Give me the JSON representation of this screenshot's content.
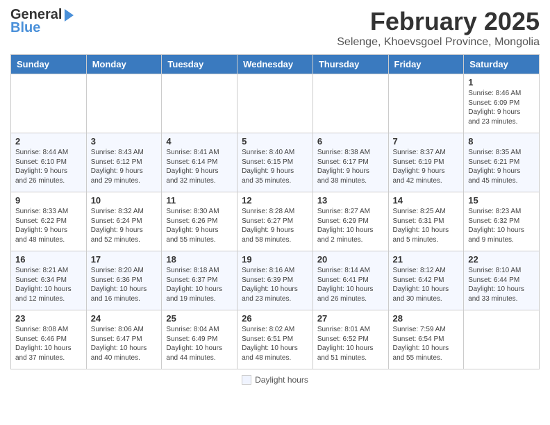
{
  "header": {
    "logo_line1": "General",
    "logo_line2": "Blue",
    "month_title": "February 2025",
    "subtitle": "Selenge, Khoevsgoel Province, Mongolia"
  },
  "weekdays": [
    "Sunday",
    "Monday",
    "Tuesday",
    "Wednesday",
    "Thursday",
    "Friday",
    "Saturday"
  ],
  "weeks": [
    [
      {
        "day": "",
        "info": ""
      },
      {
        "day": "",
        "info": ""
      },
      {
        "day": "",
        "info": ""
      },
      {
        "day": "",
        "info": ""
      },
      {
        "day": "",
        "info": ""
      },
      {
        "day": "",
        "info": ""
      },
      {
        "day": "1",
        "info": "Sunrise: 8:46 AM\nSunset: 6:09 PM\nDaylight: 9 hours\nand 23 minutes."
      }
    ],
    [
      {
        "day": "2",
        "info": "Sunrise: 8:44 AM\nSunset: 6:10 PM\nDaylight: 9 hours\nand 26 minutes."
      },
      {
        "day": "3",
        "info": "Sunrise: 8:43 AM\nSunset: 6:12 PM\nDaylight: 9 hours\nand 29 minutes."
      },
      {
        "day": "4",
        "info": "Sunrise: 8:41 AM\nSunset: 6:14 PM\nDaylight: 9 hours\nand 32 minutes."
      },
      {
        "day": "5",
        "info": "Sunrise: 8:40 AM\nSunset: 6:15 PM\nDaylight: 9 hours\nand 35 minutes."
      },
      {
        "day": "6",
        "info": "Sunrise: 8:38 AM\nSunset: 6:17 PM\nDaylight: 9 hours\nand 38 minutes."
      },
      {
        "day": "7",
        "info": "Sunrise: 8:37 AM\nSunset: 6:19 PM\nDaylight: 9 hours\nand 42 minutes."
      },
      {
        "day": "8",
        "info": "Sunrise: 8:35 AM\nSunset: 6:21 PM\nDaylight: 9 hours\nand 45 minutes."
      }
    ],
    [
      {
        "day": "9",
        "info": "Sunrise: 8:33 AM\nSunset: 6:22 PM\nDaylight: 9 hours\nand 48 minutes."
      },
      {
        "day": "10",
        "info": "Sunrise: 8:32 AM\nSunset: 6:24 PM\nDaylight: 9 hours\nand 52 minutes."
      },
      {
        "day": "11",
        "info": "Sunrise: 8:30 AM\nSunset: 6:26 PM\nDaylight: 9 hours\nand 55 minutes."
      },
      {
        "day": "12",
        "info": "Sunrise: 8:28 AM\nSunset: 6:27 PM\nDaylight: 9 hours\nand 58 minutes."
      },
      {
        "day": "13",
        "info": "Sunrise: 8:27 AM\nSunset: 6:29 PM\nDaylight: 10 hours\nand 2 minutes."
      },
      {
        "day": "14",
        "info": "Sunrise: 8:25 AM\nSunset: 6:31 PM\nDaylight: 10 hours\nand 5 minutes."
      },
      {
        "day": "15",
        "info": "Sunrise: 8:23 AM\nSunset: 6:32 PM\nDaylight: 10 hours\nand 9 minutes."
      }
    ],
    [
      {
        "day": "16",
        "info": "Sunrise: 8:21 AM\nSunset: 6:34 PM\nDaylight: 10 hours\nand 12 minutes."
      },
      {
        "day": "17",
        "info": "Sunrise: 8:20 AM\nSunset: 6:36 PM\nDaylight: 10 hours\nand 16 minutes."
      },
      {
        "day": "18",
        "info": "Sunrise: 8:18 AM\nSunset: 6:37 PM\nDaylight: 10 hours\nand 19 minutes."
      },
      {
        "day": "19",
        "info": "Sunrise: 8:16 AM\nSunset: 6:39 PM\nDaylight: 10 hours\nand 23 minutes."
      },
      {
        "day": "20",
        "info": "Sunrise: 8:14 AM\nSunset: 6:41 PM\nDaylight: 10 hours\nand 26 minutes."
      },
      {
        "day": "21",
        "info": "Sunrise: 8:12 AM\nSunset: 6:42 PM\nDaylight: 10 hours\nand 30 minutes."
      },
      {
        "day": "22",
        "info": "Sunrise: 8:10 AM\nSunset: 6:44 PM\nDaylight: 10 hours\nand 33 minutes."
      }
    ],
    [
      {
        "day": "23",
        "info": "Sunrise: 8:08 AM\nSunset: 6:46 PM\nDaylight: 10 hours\nand 37 minutes."
      },
      {
        "day": "24",
        "info": "Sunrise: 8:06 AM\nSunset: 6:47 PM\nDaylight: 10 hours\nand 40 minutes."
      },
      {
        "day": "25",
        "info": "Sunrise: 8:04 AM\nSunset: 6:49 PM\nDaylight: 10 hours\nand 44 minutes."
      },
      {
        "day": "26",
        "info": "Sunrise: 8:02 AM\nSunset: 6:51 PM\nDaylight: 10 hours\nand 48 minutes."
      },
      {
        "day": "27",
        "info": "Sunrise: 8:01 AM\nSunset: 6:52 PM\nDaylight: 10 hours\nand 51 minutes."
      },
      {
        "day": "28",
        "info": "Sunrise: 7:59 AM\nSunset: 6:54 PM\nDaylight: 10 hours\nand 55 minutes."
      },
      {
        "day": "",
        "info": ""
      }
    ]
  ],
  "footer": {
    "label": "Daylight hours"
  }
}
